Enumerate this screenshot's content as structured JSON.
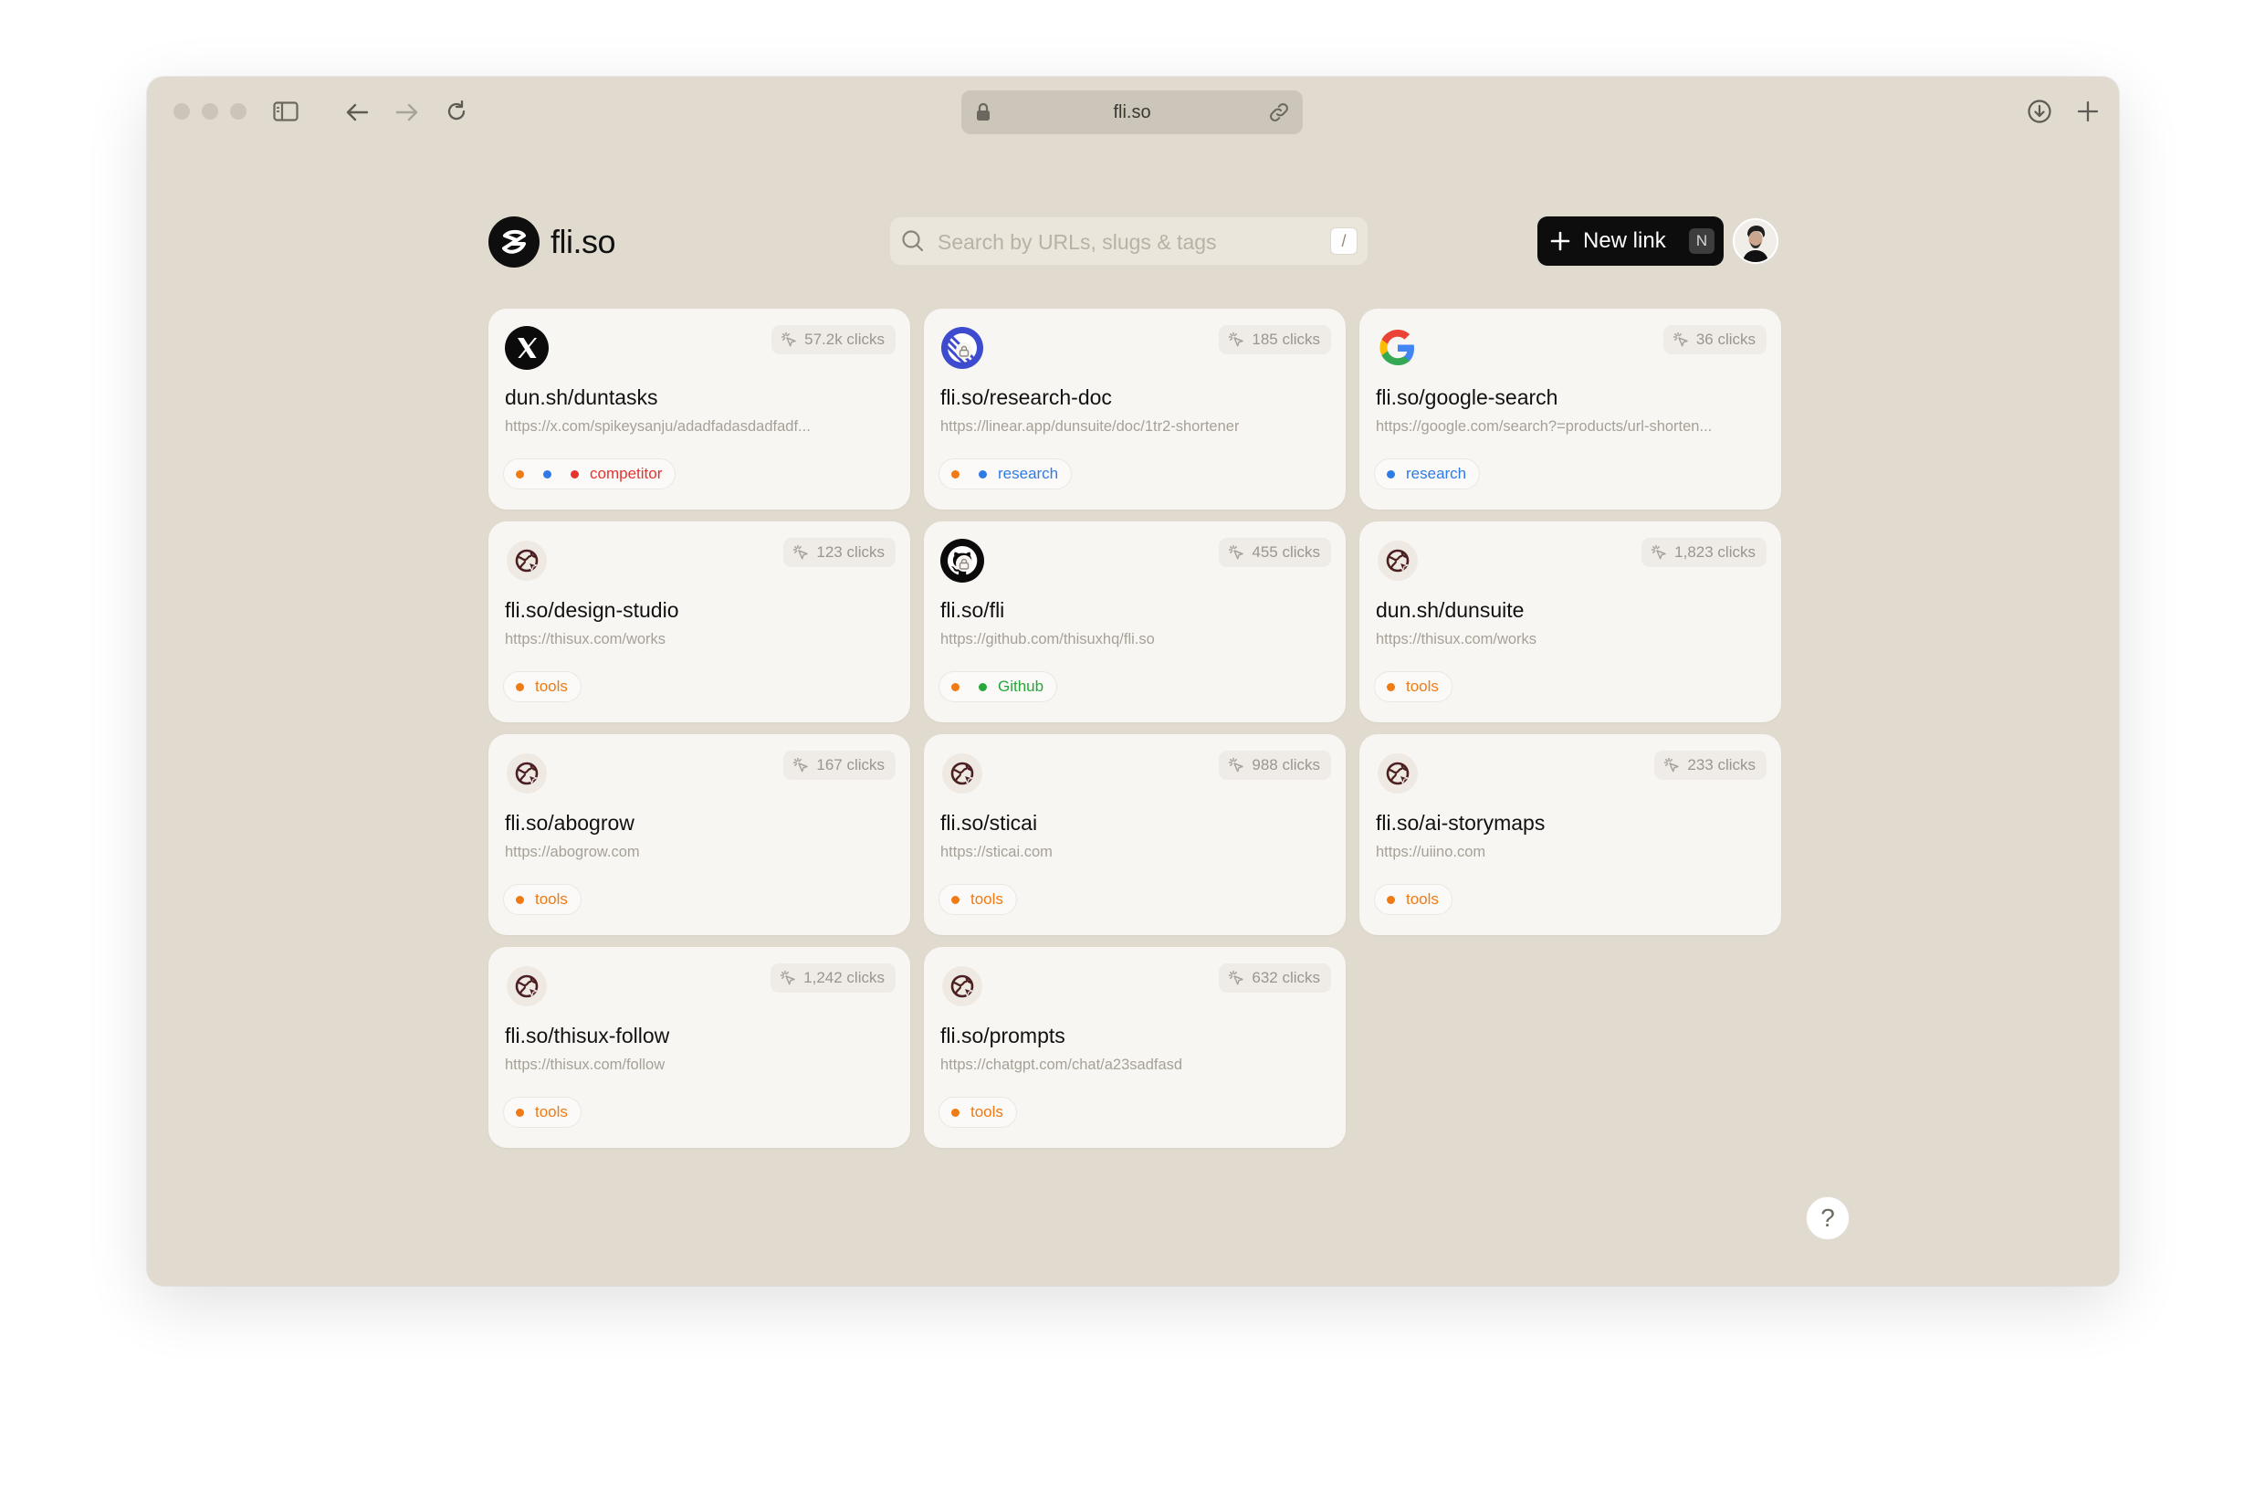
{
  "browser": {
    "address": "fli.so"
  },
  "app": {
    "logo_text": "fli.so",
    "search_placeholder": "Search by URLs, slugs & tags",
    "search_shortcut": "/",
    "new_link_label": "New link",
    "new_link_shortcut": "N",
    "help_label": "?"
  },
  "colors": {
    "window_bg": "#e1dbcf",
    "card_bg": "#f8f6f3",
    "orange": "#f07a14",
    "blue": "#2f7be6",
    "red": "#e5342d",
    "green": "#27a838"
  },
  "links": [
    {
      "icon": "x-logo-icon",
      "clicks": "57.2k clicks",
      "slug": "dun.sh/duntasks",
      "url": "https://x.com/spikeysanju/adadfadasdadfadf...",
      "dots": [
        "#f07a14",
        "#2f7be6",
        "#e5342d"
      ],
      "tag": "competitor",
      "tag_color": "#e5342d"
    },
    {
      "icon": "linear-logo-icon",
      "locked": true,
      "clicks": "185 clicks",
      "slug": "fli.so/research-doc",
      "url": "https://linear.app/dunsuite/doc/1tr2-shortener",
      "dots": [
        "#f07a14",
        "#2f7be6"
      ],
      "tag": "research",
      "tag_color": "#2f7be6"
    },
    {
      "icon": "google-logo-icon",
      "clicks": "36 clicks",
      "slug": "fli.so/google-search",
      "url": "https://google.com/search?=products/url-shorten...",
      "dots": [
        "#2f7be6"
      ],
      "tag": "research",
      "tag_color": "#2f7be6"
    },
    {
      "icon": "globe-icon",
      "clicks": "123 clicks",
      "slug": "fli.so/design-studio",
      "url": "https://thisux.com/works",
      "dots": [
        "#f07a14"
      ],
      "tag": "tools",
      "tag_color": "#f07a14"
    },
    {
      "icon": "github-logo-icon",
      "locked": true,
      "clicks": "455 clicks",
      "slug": "fli.so/fli",
      "url": "https://github.com/thisuxhq/fli.so",
      "dots": [
        "#f07a14",
        "#27a838"
      ],
      "tag": "Github",
      "tag_color": "#27a838"
    },
    {
      "icon": "globe-icon",
      "clicks": "1,823 clicks",
      "slug": "dun.sh/dunsuite",
      "url": "https://thisux.com/works",
      "dots": [
        "#f07a14"
      ],
      "tag": "tools",
      "tag_color": "#f07a14"
    },
    {
      "icon": "globe-icon",
      "clicks": "167 clicks",
      "slug": "fli.so/abogrow",
      "url": "https://abogrow.com",
      "dots": [
        "#f07a14"
      ],
      "tag": "tools",
      "tag_color": "#f07a14"
    },
    {
      "icon": "globe-icon",
      "clicks": "988 clicks",
      "slug": "fli.so/sticai",
      "url": "https://sticai.com",
      "dots": [
        "#f07a14"
      ],
      "tag": "tools",
      "tag_color": "#f07a14"
    },
    {
      "icon": "globe-icon",
      "clicks": "233 clicks",
      "slug": "fli.so/ai-storymaps",
      "url": "https://uiino.com",
      "dots": [
        "#f07a14"
      ],
      "tag": "tools",
      "tag_color": "#f07a14"
    },
    {
      "icon": "globe-icon",
      "clicks": "1,242 clicks",
      "slug": "fli.so/thisux-follow",
      "url": "https://thisux.com/follow",
      "dots": [
        "#f07a14"
      ],
      "tag": "tools",
      "tag_color": "#f07a14"
    },
    {
      "icon": "globe-icon",
      "clicks": "632 clicks",
      "slug": "fli.so/prompts",
      "url": "https://chatgpt.com/chat/a23sadfasd",
      "dots": [
        "#f07a14"
      ],
      "tag": "tools",
      "tag_color": "#f07a14"
    }
  ]
}
